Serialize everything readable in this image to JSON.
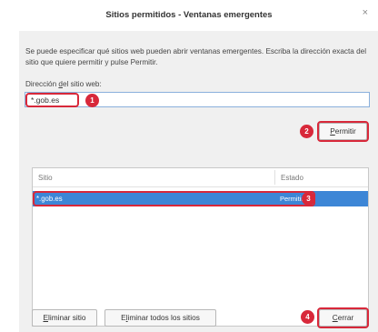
{
  "dialog": {
    "title": "Sitios permitidos - Ventanas emergentes",
    "close_label": "×"
  },
  "description": "Se puede especificar qué sitios web pueden abrir ventanas emergentes. Escriba la dirección exacta del sitio que quiere permitir y pulse Permitir.",
  "address": {
    "label_pre": "Dirección ",
    "label_accel": "d",
    "label_post": "el sitio web:",
    "value": "*.gob.es"
  },
  "buttons": {
    "permitir_accel": "P",
    "permitir_rest": "ermitir",
    "eliminar_sitio_accel": "E",
    "eliminar_sitio_rest": "liminar sitio",
    "eliminar_todos_pre": "E",
    "eliminar_todos_accel": "l",
    "eliminar_todos_rest": "iminar todos los sitios",
    "cerrar_accel": "C",
    "cerrar_rest": "errar"
  },
  "table": {
    "columns": [
      "Sitio",
      "Estado"
    ],
    "rows": [
      {
        "site": "*.gob.es",
        "state": "Permitir"
      }
    ]
  },
  "steps": [
    "1",
    "2",
    "3",
    "4"
  ],
  "colors": {
    "highlight": "#d8283a",
    "selection": "#3d86d6"
  }
}
